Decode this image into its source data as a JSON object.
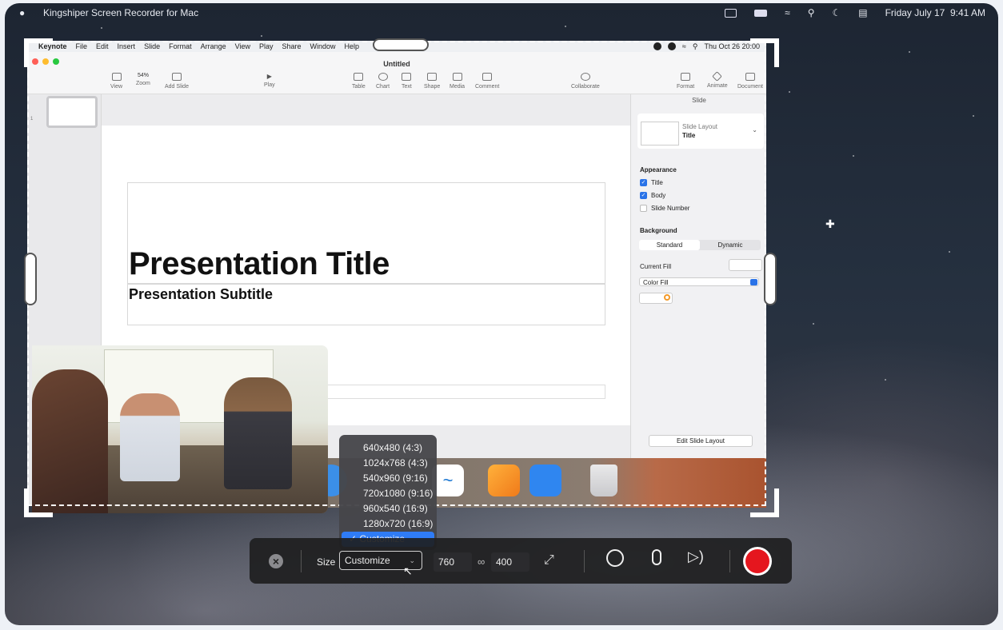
{
  "menubar": {
    "app_name": "Kingshiper Screen Recorder for Mac",
    "date": "Friday July 17",
    "time": "9:41 AM"
  },
  "keynote": {
    "menu": [
      "Keynote",
      "File",
      "Edit",
      "Insert",
      "Slide",
      "Format",
      "Arrange",
      "View",
      "Play",
      "Share",
      "Window",
      "Help"
    ],
    "clock": "Thu Oct 26  20:00",
    "window_title": "Untitled",
    "toolbar": {
      "view": "View",
      "zoom_value": "54%",
      "zoom": "Zoom",
      "add_slide": "Add Slide",
      "play": "Play",
      "table": "Table",
      "chart": "Chart",
      "text": "Text",
      "shape": "Shape",
      "media": "Media",
      "comment": "Comment",
      "collaborate": "Collaborate",
      "format": "Format",
      "animate": "Animate",
      "document": "Document"
    },
    "slide_number": "1",
    "slide": {
      "title": "Presentation Title",
      "subtitle": "Presentation Subtitle"
    },
    "inspector": {
      "header": "Slide",
      "layout_label": "Slide Layout",
      "layout_value": "Title",
      "appearance": "Appearance",
      "chk_title": "Title",
      "chk_body": "Body",
      "chk_slide_number": "Slide Number",
      "background": "Background",
      "seg_standard": "Standard",
      "seg_dynamic": "Dynamic",
      "current_fill": "Current Fill",
      "color_fill": "Color Fill",
      "edit_layout": "Edit Slide Layout"
    }
  },
  "size_dropdown": {
    "options": [
      "640x480 (4:3)",
      "1024x768 (4:3)",
      "540x960 (9:16)",
      "720x1080 (9:16)",
      "960x540 (16:9)",
      "1280x720 (16:9)"
    ],
    "selected_option": "Customize"
  },
  "recorder_bar": {
    "size_label": "Size",
    "size_value": "Customize",
    "width": "760",
    "height": "400"
  },
  "colors": {
    "accent": "#2f7cf6",
    "record": "#e5161e"
  }
}
